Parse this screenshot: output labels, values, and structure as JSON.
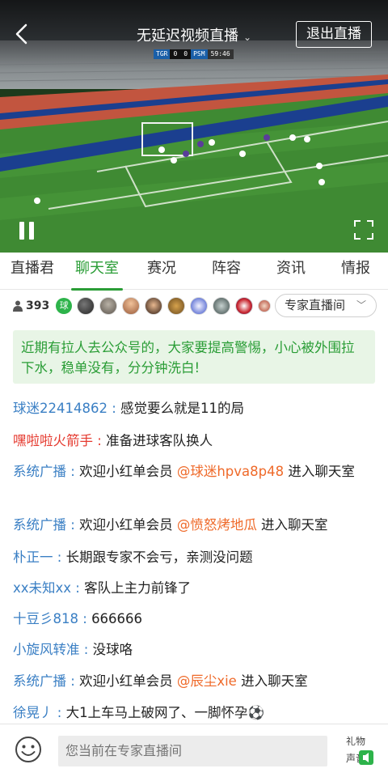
{
  "video": {
    "title": "无延迟视频直播",
    "exit_label": "退出直播",
    "scorebug": {
      "home": "TGR",
      "home_score": "0",
      "away_score": "0",
      "away": "PSM",
      "clock": "59:46"
    }
  },
  "tabs": [
    "直播君",
    "聊天室",
    "赛况",
    "阵容",
    "资讯",
    "情报"
  ],
  "active_tab": 1,
  "info": {
    "online_count": "393",
    "ball_badge": "球",
    "expert_button": "专家直播间"
  },
  "notice": "近期有拉人去公众号的，大家要提高警惕，小心被外围拉下水，稳单没有，分分钟洗白!",
  "messages": [
    {
      "user": "球迷22414862",
      "sep": " : ",
      "text": "感觉要么就是11的局"
    },
    {
      "user": "嘿啦啦火箭手",
      "sep": " : ",
      "text": "准备进球客队换人"
    },
    {
      "user": "系统广播",
      "sep": " : ",
      "text": "欢迎小红单会员 ",
      "mention": "@球迷hpva8p48",
      "tail": " 进入聊天室"
    },
    {
      "user": "系统广播",
      "sep": " : ",
      "text": "欢迎小红单会员 ",
      "mention": "@愤怒烤地瓜",
      "tail": " 进入聊天室"
    },
    {
      "user": "朴正一",
      "sep": " : ",
      "text": "长期跟专家不会亏，亲测没问题"
    },
    {
      "user": "xx未知xx",
      "sep": " : ",
      "text": "客队上主力前锋了"
    },
    {
      "user": "十豆彡818",
      "sep": " : ",
      "text": "666666"
    },
    {
      "user": "小旋风转准",
      "sep": " : ",
      "text": "没球咯"
    },
    {
      "user": "系统广播",
      "sep": " : ",
      "text": "欢迎小红单会员 ",
      "mention": "@辰尘xie",
      "tail": " 进入聊天室"
    },
    {
      "user": "徐晃丿",
      "sep": " : ",
      "text": "大1上车马上破网了、一脚怀孕⚽"
    }
  ],
  "input_placeholder": "您当前在专家直播间",
  "gift_label": "礼物声音",
  "colors": {
    "accent": "#2a9d36",
    "user_blue": "#3a7fc4",
    "user_red": "#e53a2f",
    "mention": "#ef6a2a"
  }
}
